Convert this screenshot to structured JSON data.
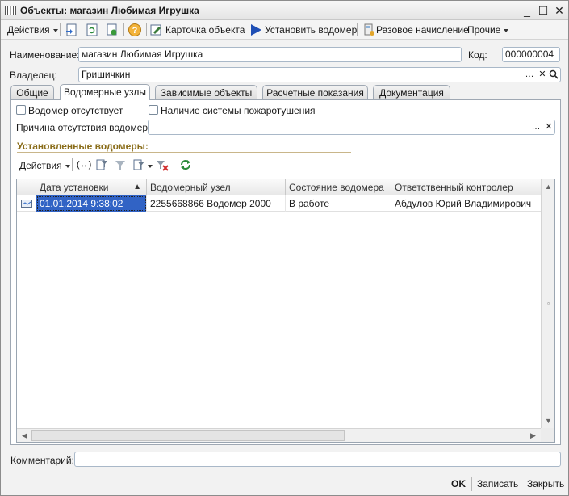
{
  "window": {
    "title": "Объекты: магазин Любимая Игрушка"
  },
  "toolbar": {
    "actions_label": "Действия",
    "card_label": "Карточка объекта",
    "install_meter_label": "Установить водомер",
    "one_time_charge_label": "Разовое начисление",
    "other_label": "Прочие"
  },
  "form": {
    "name_label": "Наименование:",
    "name_value": "магазин Любимая Игрушка",
    "code_label": "Код:",
    "code_value": "000000004",
    "owner_label": "Владелец:",
    "owner_value": "Гришичкин"
  },
  "tabs": [
    {
      "label": "Общие"
    },
    {
      "label": "Водомерные узлы"
    },
    {
      "label": "Зависимые объекты"
    },
    {
      "label": "Расчетные показания"
    },
    {
      "label": "Документация"
    }
  ],
  "meter_tab": {
    "no_meter_label": "Водомер отсутствует",
    "fire_system_label": "Наличие системы пожаротушения",
    "reason_label": "Причина отсутствия водомера:",
    "reason_value": "",
    "section_title": "Установленные водомеры:",
    "grid_actions_label": "Действия"
  },
  "grid": {
    "columns": [
      "Дата установки",
      "Водомерный узел",
      "Состояние водомера",
      "Ответственный контролер"
    ],
    "rows": [
      [
        "01.01.2014 9:38:02",
        "2255668866 Водомер 2000",
        "В работе",
        "Абдулов Юрий Владимирович"
      ]
    ]
  },
  "footer": {
    "comment_label": "Комментарий:",
    "comment_value": "",
    "ok_label": "OK",
    "save_label": "Записать",
    "close_label": "Закрыть"
  },
  "colors": {
    "accent": "#3163c5",
    "section_title": "#8a6d1a",
    "install_arrow": "#1f4fb5"
  }
}
